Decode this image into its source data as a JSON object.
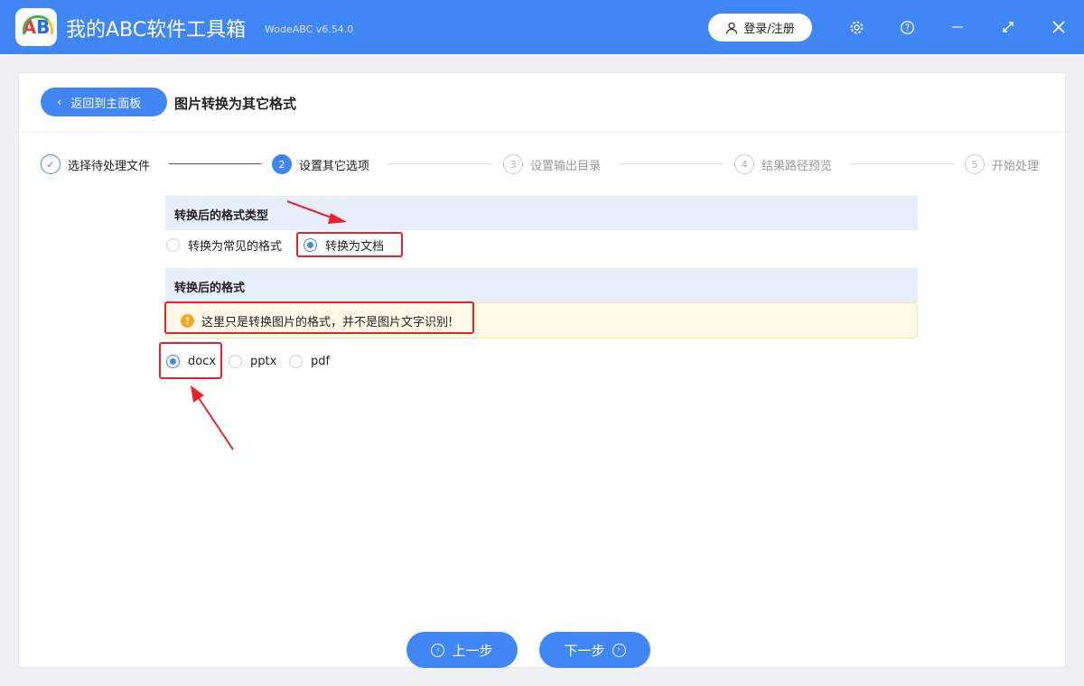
{
  "app": {
    "title": "我的ABC软件工具箱",
    "version": "WodeABC v6.54.0",
    "logo_text": "AB",
    "login": "登录/注册"
  },
  "header": {
    "back": "返回到主面板",
    "title": "图片转换为其它格式"
  },
  "steps": [
    {
      "n": "✓",
      "label": "选择待处理文件"
    },
    {
      "n": "2",
      "label": "设置其它选项"
    },
    {
      "n": "3",
      "label": "设置输出目录"
    },
    {
      "n": "4",
      "label": "结果路径预览"
    },
    {
      "n": "5",
      "label": "开始处理"
    }
  ],
  "section1": {
    "title": "转换后的格式类型",
    "options": [
      "转换为常见的格式",
      "转换为文档"
    ],
    "selected": 1
  },
  "section2": {
    "title": "转换后的格式",
    "notice": "这里只是转换图片的格式，并不是图片文字识别!",
    "options": [
      "docx",
      "pptx",
      "pdf"
    ],
    "selected": 0
  },
  "footer": {
    "prev": "上一步",
    "next": "下一步"
  },
  "colors": {
    "accent": "#4086f4",
    "highlight": "#e8242a"
  }
}
